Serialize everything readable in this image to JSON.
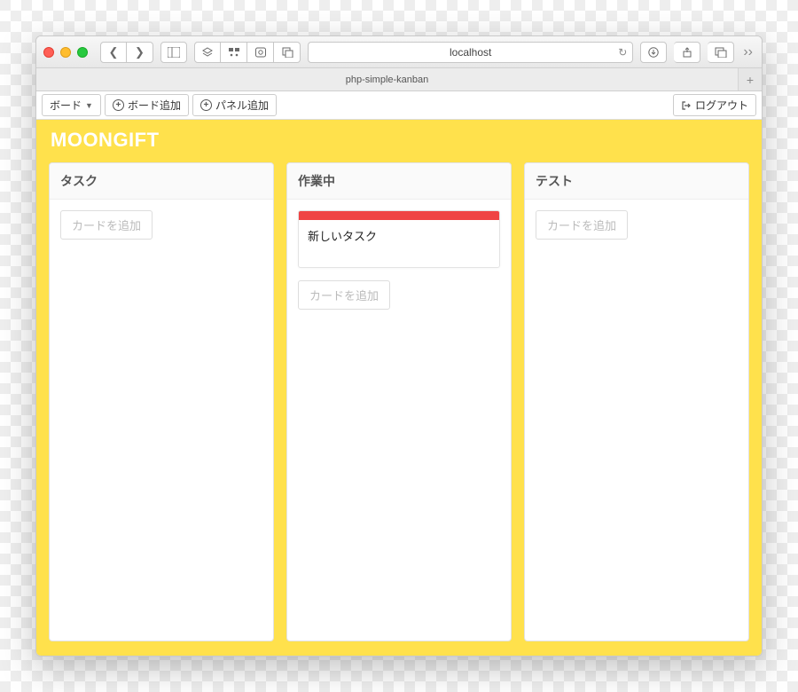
{
  "browser": {
    "url": "localhost",
    "tab_title": "php-simple-kanban"
  },
  "toolbar": {
    "board_menu_label": "ボード",
    "add_board_label": "ボード追加",
    "add_panel_label": "パネル追加",
    "logout_label": "ログアウト"
  },
  "board": {
    "title": "MOONGIFT",
    "add_card_label": "カードを追加",
    "lanes": [
      {
        "title": "タスク",
        "cards": []
      },
      {
        "title": "作業中",
        "cards": [
          {
            "title": "新しいタスク",
            "color": "#ef4444"
          }
        ]
      },
      {
        "title": "テスト",
        "cards": []
      }
    ]
  }
}
